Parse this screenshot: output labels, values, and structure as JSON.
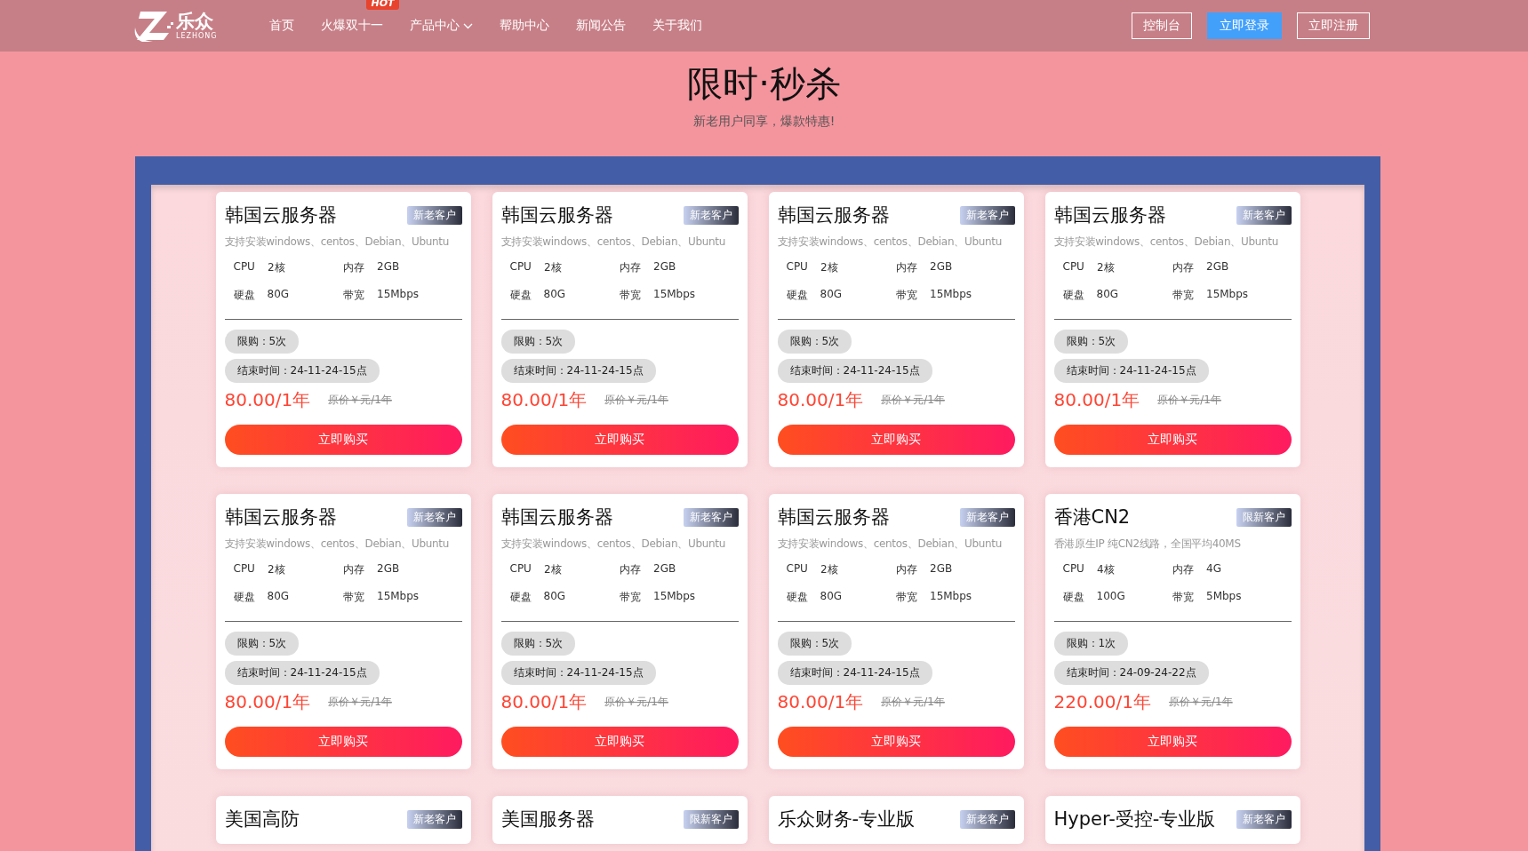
{
  "header": {
    "logo": {
      "name": "乐众",
      "sub": "LEZHONG"
    },
    "nav": [
      {
        "label": "首页",
        "dropdown": false
      },
      {
        "label": "火爆双十一",
        "badge": "HOT",
        "dropdown": false
      },
      {
        "label": "产品中心",
        "dropdown": true
      },
      {
        "label": "帮助中心",
        "dropdown": false
      },
      {
        "label": "新闻公告",
        "dropdown": false
      },
      {
        "label": "关于我们",
        "dropdown": false
      }
    ],
    "buttons": [
      {
        "label": "控制台",
        "kind": "outline"
      },
      {
        "label": "立即登录",
        "kind": "solid"
      },
      {
        "label": "立即注册",
        "kind": "outline"
      }
    ]
  },
  "hero": {
    "title": "限时·秒杀",
    "subtitle": "新老用户同享，爆款特惠!"
  },
  "cards": [
    {
      "title": "韩国云服务器",
      "tag": "新老客户",
      "desc": "支持安装windows、centos、Debian、Ubuntu",
      "specs": [
        {
          "label": "CPU",
          "value": "2核"
        },
        {
          "label": "内存",
          "value": "2GB"
        },
        {
          "label": "硬盘",
          "value": "80G"
        },
        {
          "label": "带宽",
          "value": "15Mbps"
        }
      ],
      "limit": "限购：5次",
      "end_time": "结束时间：24-11-24-15点",
      "price": "80.00/1年",
      "original_price": "原价￥元/1年",
      "button": "立即购买"
    },
    {
      "title": "韩国云服务器",
      "tag": "新老客户",
      "desc": "支持安装windows、centos、Debian、Ubuntu",
      "specs": [
        {
          "label": "CPU",
          "value": "2核"
        },
        {
          "label": "内存",
          "value": "2GB"
        },
        {
          "label": "硬盘",
          "value": "80G"
        },
        {
          "label": "带宽",
          "value": "15Mbps"
        }
      ],
      "limit": "限购：5次",
      "end_time": "结束时间：24-11-24-15点",
      "price": "80.00/1年",
      "original_price": "原价￥元/1年",
      "button": "立即购买"
    },
    {
      "title": "韩国云服务器",
      "tag": "新老客户",
      "desc": "支持安装windows、centos、Debian、Ubuntu",
      "specs": [
        {
          "label": "CPU",
          "value": "2核"
        },
        {
          "label": "内存",
          "value": "2GB"
        },
        {
          "label": "硬盘",
          "value": "80G"
        },
        {
          "label": "带宽",
          "value": "15Mbps"
        }
      ],
      "limit": "限购：5次",
      "end_time": "结束时间：24-11-24-15点",
      "price": "80.00/1年",
      "original_price": "原价￥元/1年",
      "button": "立即购买"
    },
    {
      "title": "韩国云服务器",
      "tag": "新老客户",
      "desc": "支持安装windows、centos、Debian、Ubuntu",
      "specs": [
        {
          "label": "CPU",
          "value": "2核"
        },
        {
          "label": "内存",
          "value": "2GB"
        },
        {
          "label": "硬盘",
          "value": "80G"
        },
        {
          "label": "带宽",
          "value": "15Mbps"
        }
      ],
      "limit": "限购：5次",
      "end_time": "结束时间：24-11-24-15点",
      "price": "80.00/1年",
      "original_price": "原价￥元/1年",
      "button": "立即购买"
    },
    {
      "title": "韩国云服务器",
      "tag": "新老客户",
      "desc": "支持安装windows、centos、Debian、Ubuntu",
      "specs": [
        {
          "label": "CPU",
          "value": "2核"
        },
        {
          "label": "内存",
          "value": "2GB"
        },
        {
          "label": "硬盘",
          "value": "80G"
        },
        {
          "label": "带宽",
          "value": "15Mbps"
        }
      ],
      "limit": "限购：5次",
      "end_time": "结束时间：24-11-24-15点",
      "price": "80.00/1年",
      "original_price": "原价￥元/1年",
      "button": "立即购买"
    },
    {
      "title": "韩国云服务器",
      "tag": "新老客户",
      "desc": "支持安装windows、centos、Debian、Ubuntu",
      "specs": [
        {
          "label": "CPU",
          "value": "2核"
        },
        {
          "label": "内存",
          "value": "2GB"
        },
        {
          "label": "硬盘",
          "value": "80G"
        },
        {
          "label": "带宽",
          "value": "15Mbps"
        }
      ],
      "limit": "限购：5次",
      "end_time": "结束时间：24-11-24-15点",
      "price": "80.00/1年",
      "original_price": "原价￥元/1年",
      "button": "立即购买"
    },
    {
      "title": "韩国云服务器",
      "tag": "新老客户",
      "desc": "支持安装windows、centos、Debian、Ubuntu",
      "specs": [
        {
          "label": "CPU",
          "value": "2核"
        },
        {
          "label": "内存",
          "value": "2GB"
        },
        {
          "label": "硬盘",
          "value": "80G"
        },
        {
          "label": "带宽",
          "value": "15Mbps"
        }
      ],
      "limit": "限购：5次",
      "end_time": "结束时间：24-11-24-15点",
      "price": "80.00/1年",
      "original_price": "原价￥元/1年",
      "button": "立即购买"
    },
    {
      "title": "香港CN2",
      "tag": "限新客户",
      "desc": "香港原生IP 纯CN2线路，全国平均40MS",
      "specs": [
        {
          "label": "CPU",
          "value": "4核"
        },
        {
          "label": "内存",
          "value": "4G"
        },
        {
          "label": "硬盘",
          "value": "100G"
        },
        {
          "label": "带宽",
          "value": "5Mbps"
        }
      ],
      "limit": "限购：1次",
      "end_time": "结束时间：24-09-24-22点",
      "price": "220.00/1年",
      "original_price": "原价￥元/1年",
      "button": "立即购买"
    },
    {
      "title": "美国高防",
      "tag": "新老客户"
    },
    {
      "title": "美国服务器",
      "tag": "限新客户"
    },
    {
      "title": "乐众财务-专业版",
      "tag": "新老客户"
    },
    {
      "title": "Hyper-受控-专业版",
      "tag": "新老客户"
    }
  ]
}
